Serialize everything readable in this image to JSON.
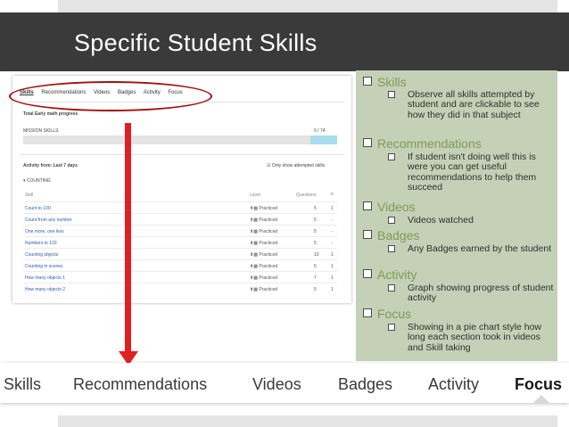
{
  "slide": {
    "title": "Specific Student Skills"
  },
  "screenshot": {
    "tabs": [
      "Skills",
      "Recommendations",
      "Videos",
      "Badges",
      "Activity",
      "Focus"
    ],
    "progress_title": "Total Early math progress",
    "mission_label": "MISSION SKILLS",
    "mission_count": "0 / 74",
    "activity_label": "Activity from: Last 7 days",
    "show_attempted": "Only show attempted skills",
    "section": "COUNTING",
    "columns": {
      "skill": "Skill",
      "level": "Level",
      "questions": "Questions"
    },
    "rows": [
      {
        "skill": "Count to 100",
        "level": "Practiced",
        "questions": "5",
        "extra": "1"
      },
      {
        "skill": "Count from any number",
        "level": "Practiced",
        "questions": "5",
        "extra": "-"
      },
      {
        "skill": "One more, one less",
        "level": "Practiced",
        "questions": "5",
        "extra": "-"
      },
      {
        "skill": "Numbers to 120",
        "level": "Practiced",
        "questions": "5",
        "extra": "-"
      },
      {
        "skill": "Counting objects",
        "level": "Practiced",
        "questions": "10",
        "extra": "1"
      },
      {
        "skill": "Counting in scenes",
        "level": "Practiced",
        "questions": "5",
        "extra": "1"
      },
      {
        "skill": "How many objects 1",
        "level": "Practiced",
        "questions": "7",
        "extra": "1"
      },
      {
        "skill": "How many objects 2",
        "level": "Practiced",
        "questions": "5",
        "extra": "1"
      }
    ]
  },
  "panel": {
    "items": [
      {
        "heading": "Skills",
        "bullet": "Observe all skills attempted by student and are clickable to see how they did in that subject"
      },
      {
        "heading": "Recommendations",
        "bullet": "If student isn't doing well this is were you can get useful recommendations to help them succeed"
      },
      {
        "heading": "Videos",
        "bullet": "Videos watched"
      },
      {
        "heading": "Badges",
        "bullet": "Any Badges earned by the student"
      },
      {
        "heading": "Activity",
        "bullet": "Graph showing progress of student activity"
      },
      {
        "heading": "Focus",
        "bullet": "Showing in a pie chart style how long each section took in videos and Skill taking"
      }
    ]
  },
  "tabstrip": {
    "tabs": [
      "Skills",
      "Recommendations",
      "Videos",
      "Badges",
      "Activity",
      "Focus"
    ],
    "active": "Focus"
  },
  "colors": {
    "title_bar": "#3a3a3a",
    "panel": "#c4d1b7",
    "heading": "#7f9a55",
    "arrow": "#e02020",
    "ellipse": "#a31111"
  }
}
